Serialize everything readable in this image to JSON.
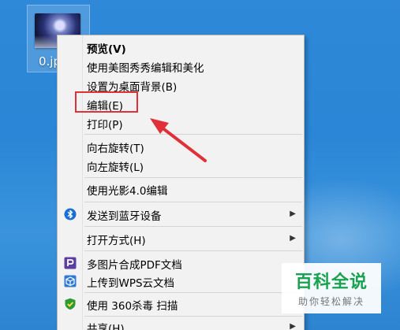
{
  "desktop": {
    "file_name": "0.jp"
  },
  "menu": {
    "items": [
      {
        "label": "预览(V)"
      },
      {
        "label": "使用美图秀秀编辑和美化"
      },
      {
        "label": "设置为桌面背景(B)"
      },
      {
        "label": "编辑(E)"
      },
      {
        "label": "打印(P)"
      },
      {
        "label": "向右旋转(T)"
      },
      {
        "label": "向左旋转(L)"
      },
      {
        "label": "使用光影4.0编辑"
      },
      {
        "label": "发送到蓝牙设备",
        "icon": "bluetooth-icon",
        "submenu": true
      },
      {
        "label": "打开方式(H)",
        "submenu": true
      },
      {
        "label": "多图片合成PDF文档",
        "icon": "pdf-merge-icon"
      },
      {
        "label": "上传到WPS云文档",
        "icon": "wps-cloud-icon"
      },
      {
        "label": "使用 360杀毒 扫描",
        "icon": "360-antivirus-icon"
      },
      {
        "label": "共享(H)",
        "submenu": true
      }
    ]
  },
  "annotation": {
    "highlight_color": "#e0303a"
  },
  "watermark": {
    "title": "百科全说",
    "subtitle": "助你轻松解决"
  }
}
